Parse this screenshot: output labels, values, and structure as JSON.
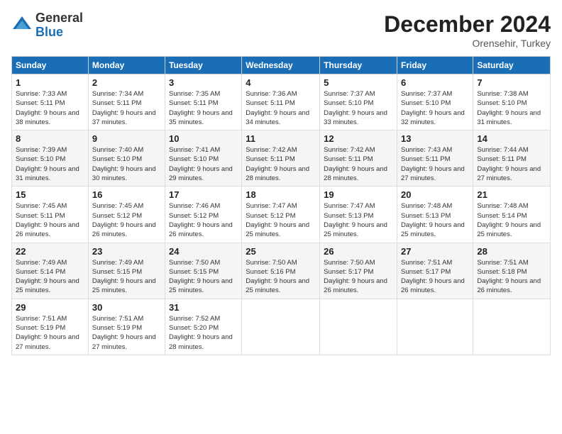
{
  "logo": {
    "general": "General",
    "blue": "Blue"
  },
  "header": {
    "month": "December 2024",
    "location": "Orensehir, Turkey"
  },
  "weekdays": [
    "Sunday",
    "Monday",
    "Tuesday",
    "Wednesday",
    "Thursday",
    "Friday",
    "Saturday"
  ],
  "weeks": [
    [
      {
        "day": "1",
        "sunrise": "7:33 AM",
        "sunset": "5:11 PM",
        "daylight": "9 hours and 38 minutes."
      },
      {
        "day": "2",
        "sunrise": "7:34 AM",
        "sunset": "5:11 PM",
        "daylight": "9 hours and 37 minutes."
      },
      {
        "day": "3",
        "sunrise": "7:35 AM",
        "sunset": "5:11 PM",
        "daylight": "9 hours and 35 minutes."
      },
      {
        "day": "4",
        "sunrise": "7:36 AM",
        "sunset": "5:11 PM",
        "daylight": "9 hours and 34 minutes."
      },
      {
        "day": "5",
        "sunrise": "7:37 AM",
        "sunset": "5:10 PM",
        "daylight": "9 hours and 33 minutes."
      },
      {
        "day": "6",
        "sunrise": "7:37 AM",
        "sunset": "5:10 PM",
        "daylight": "9 hours and 32 minutes."
      },
      {
        "day": "7",
        "sunrise": "7:38 AM",
        "sunset": "5:10 PM",
        "daylight": "9 hours and 31 minutes."
      }
    ],
    [
      {
        "day": "8",
        "sunrise": "7:39 AM",
        "sunset": "5:10 PM",
        "daylight": "9 hours and 31 minutes."
      },
      {
        "day": "9",
        "sunrise": "7:40 AM",
        "sunset": "5:10 PM",
        "daylight": "9 hours and 30 minutes."
      },
      {
        "day": "10",
        "sunrise": "7:41 AM",
        "sunset": "5:10 PM",
        "daylight": "9 hours and 29 minutes."
      },
      {
        "day": "11",
        "sunrise": "7:42 AM",
        "sunset": "5:11 PM",
        "daylight": "9 hours and 28 minutes."
      },
      {
        "day": "12",
        "sunrise": "7:42 AM",
        "sunset": "5:11 PM",
        "daylight": "9 hours and 28 minutes."
      },
      {
        "day": "13",
        "sunrise": "7:43 AM",
        "sunset": "5:11 PM",
        "daylight": "9 hours and 27 minutes."
      },
      {
        "day": "14",
        "sunrise": "7:44 AM",
        "sunset": "5:11 PM",
        "daylight": "9 hours and 27 minutes."
      }
    ],
    [
      {
        "day": "15",
        "sunrise": "7:45 AM",
        "sunset": "5:11 PM",
        "daylight": "9 hours and 26 minutes."
      },
      {
        "day": "16",
        "sunrise": "7:45 AM",
        "sunset": "5:12 PM",
        "daylight": "9 hours and 26 minutes."
      },
      {
        "day": "17",
        "sunrise": "7:46 AM",
        "sunset": "5:12 PM",
        "daylight": "9 hours and 26 minutes."
      },
      {
        "day": "18",
        "sunrise": "7:47 AM",
        "sunset": "5:12 PM",
        "daylight": "9 hours and 25 minutes."
      },
      {
        "day": "19",
        "sunrise": "7:47 AM",
        "sunset": "5:13 PM",
        "daylight": "9 hours and 25 minutes."
      },
      {
        "day": "20",
        "sunrise": "7:48 AM",
        "sunset": "5:13 PM",
        "daylight": "9 hours and 25 minutes."
      },
      {
        "day": "21",
        "sunrise": "7:48 AM",
        "sunset": "5:14 PM",
        "daylight": "9 hours and 25 minutes."
      }
    ],
    [
      {
        "day": "22",
        "sunrise": "7:49 AM",
        "sunset": "5:14 PM",
        "daylight": "9 hours and 25 minutes."
      },
      {
        "day": "23",
        "sunrise": "7:49 AM",
        "sunset": "5:15 PM",
        "daylight": "9 hours and 25 minutes."
      },
      {
        "day": "24",
        "sunrise": "7:50 AM",
        "sunset": "5:15 PM",
        "daylight": "9 hours and 25 minutes."
      },
      {
        "day": "25",
        "sunrise": "7:50 AM",
        "sunset": "5:16 PM",
        "daylight": "9 hours and 25 minutes."
      },
      {
        "day": "26",
        "sunrise": "7:50 AM",
        "sunset": "5:17 PM",
        "daylight": "9 hours and 26 minutes."
      },
      {
        "day": "27",
        "sunrise": "7:51 AM",
        "sunset": "5:17 PM",
        "daylight": "9 hours and 26 minutes."
      },
      {
        "day": "28",
        "sunrise": "7:51 AM",
        "sunset": "5:18 PM",
        "daylight": "9 hours and 26 minutes."
      }
    ],
    [
      {
        "day": "29",
        "sunrise": "7:51 AM",
        "sunset": "5:19 PM",
        "daylight": "9 hours and 27 minutes."
      },
      {
        "day": "30",
        "sunrise": "7:51 AM",
        "sunset": "5:19 PM",
        "daylight": "9 hours and 27 minutes."
      },
      {
        "day": "31",
        "sunrise": "7:52 AM",
        "sunset": "5:20 PM",
        "daylight": "9 hours and 28 minutes."
      },
      null,
      null,
      null,
      null
    ]
  ]
}
